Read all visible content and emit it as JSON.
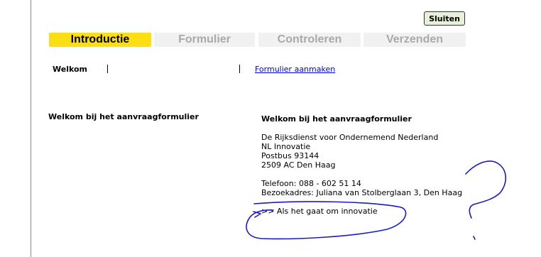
{
  "close_button": {
    "label": "Sluiten"
  },
  "tabs": [
    {
      "label": "Introductie",
      "active": true
    },
    {
      "label": "Formulier",
      "active": false
    },
    {
      "label": "Controleren",
      "active": false
    },
    {
      "label": "Verzenden",
      "active": false
    }
  ],
  "subnav": {
    "current": "Welkom",
    "link": "Formulier aanmaken"
  },
  "left": {
    "heading": "Welkom bij het aanvraagformulier"
  },
  "right": {
    "heading": "Welkom bij het aanvraagformulier",
    "address": [
      "De Rijksdienst voor Ondernemend Nederland",
      "NL Innovatie",
      "Postbus 93144",
      "2509 AC Den Haag"
    ],
    "phone": "Telefoon: 088 - 602 51 14",
    "visit_address": "Bezoekadres: Juliana van Stolberglaan 3, Den Haag",
    "innovation_link": ">> Als het gaat om innovatie"
  },
  "colors": {
    "active_tab": "#fbdf14",
    "inactive_tab": "#f1f1f1",
    "inactive_tab_text": "#a9a9a9",
    "close_button_bg": "#e7f0d8",
    "link": "#0000ee",
    "annotation_ink": "#1a1acc"
  }
}
